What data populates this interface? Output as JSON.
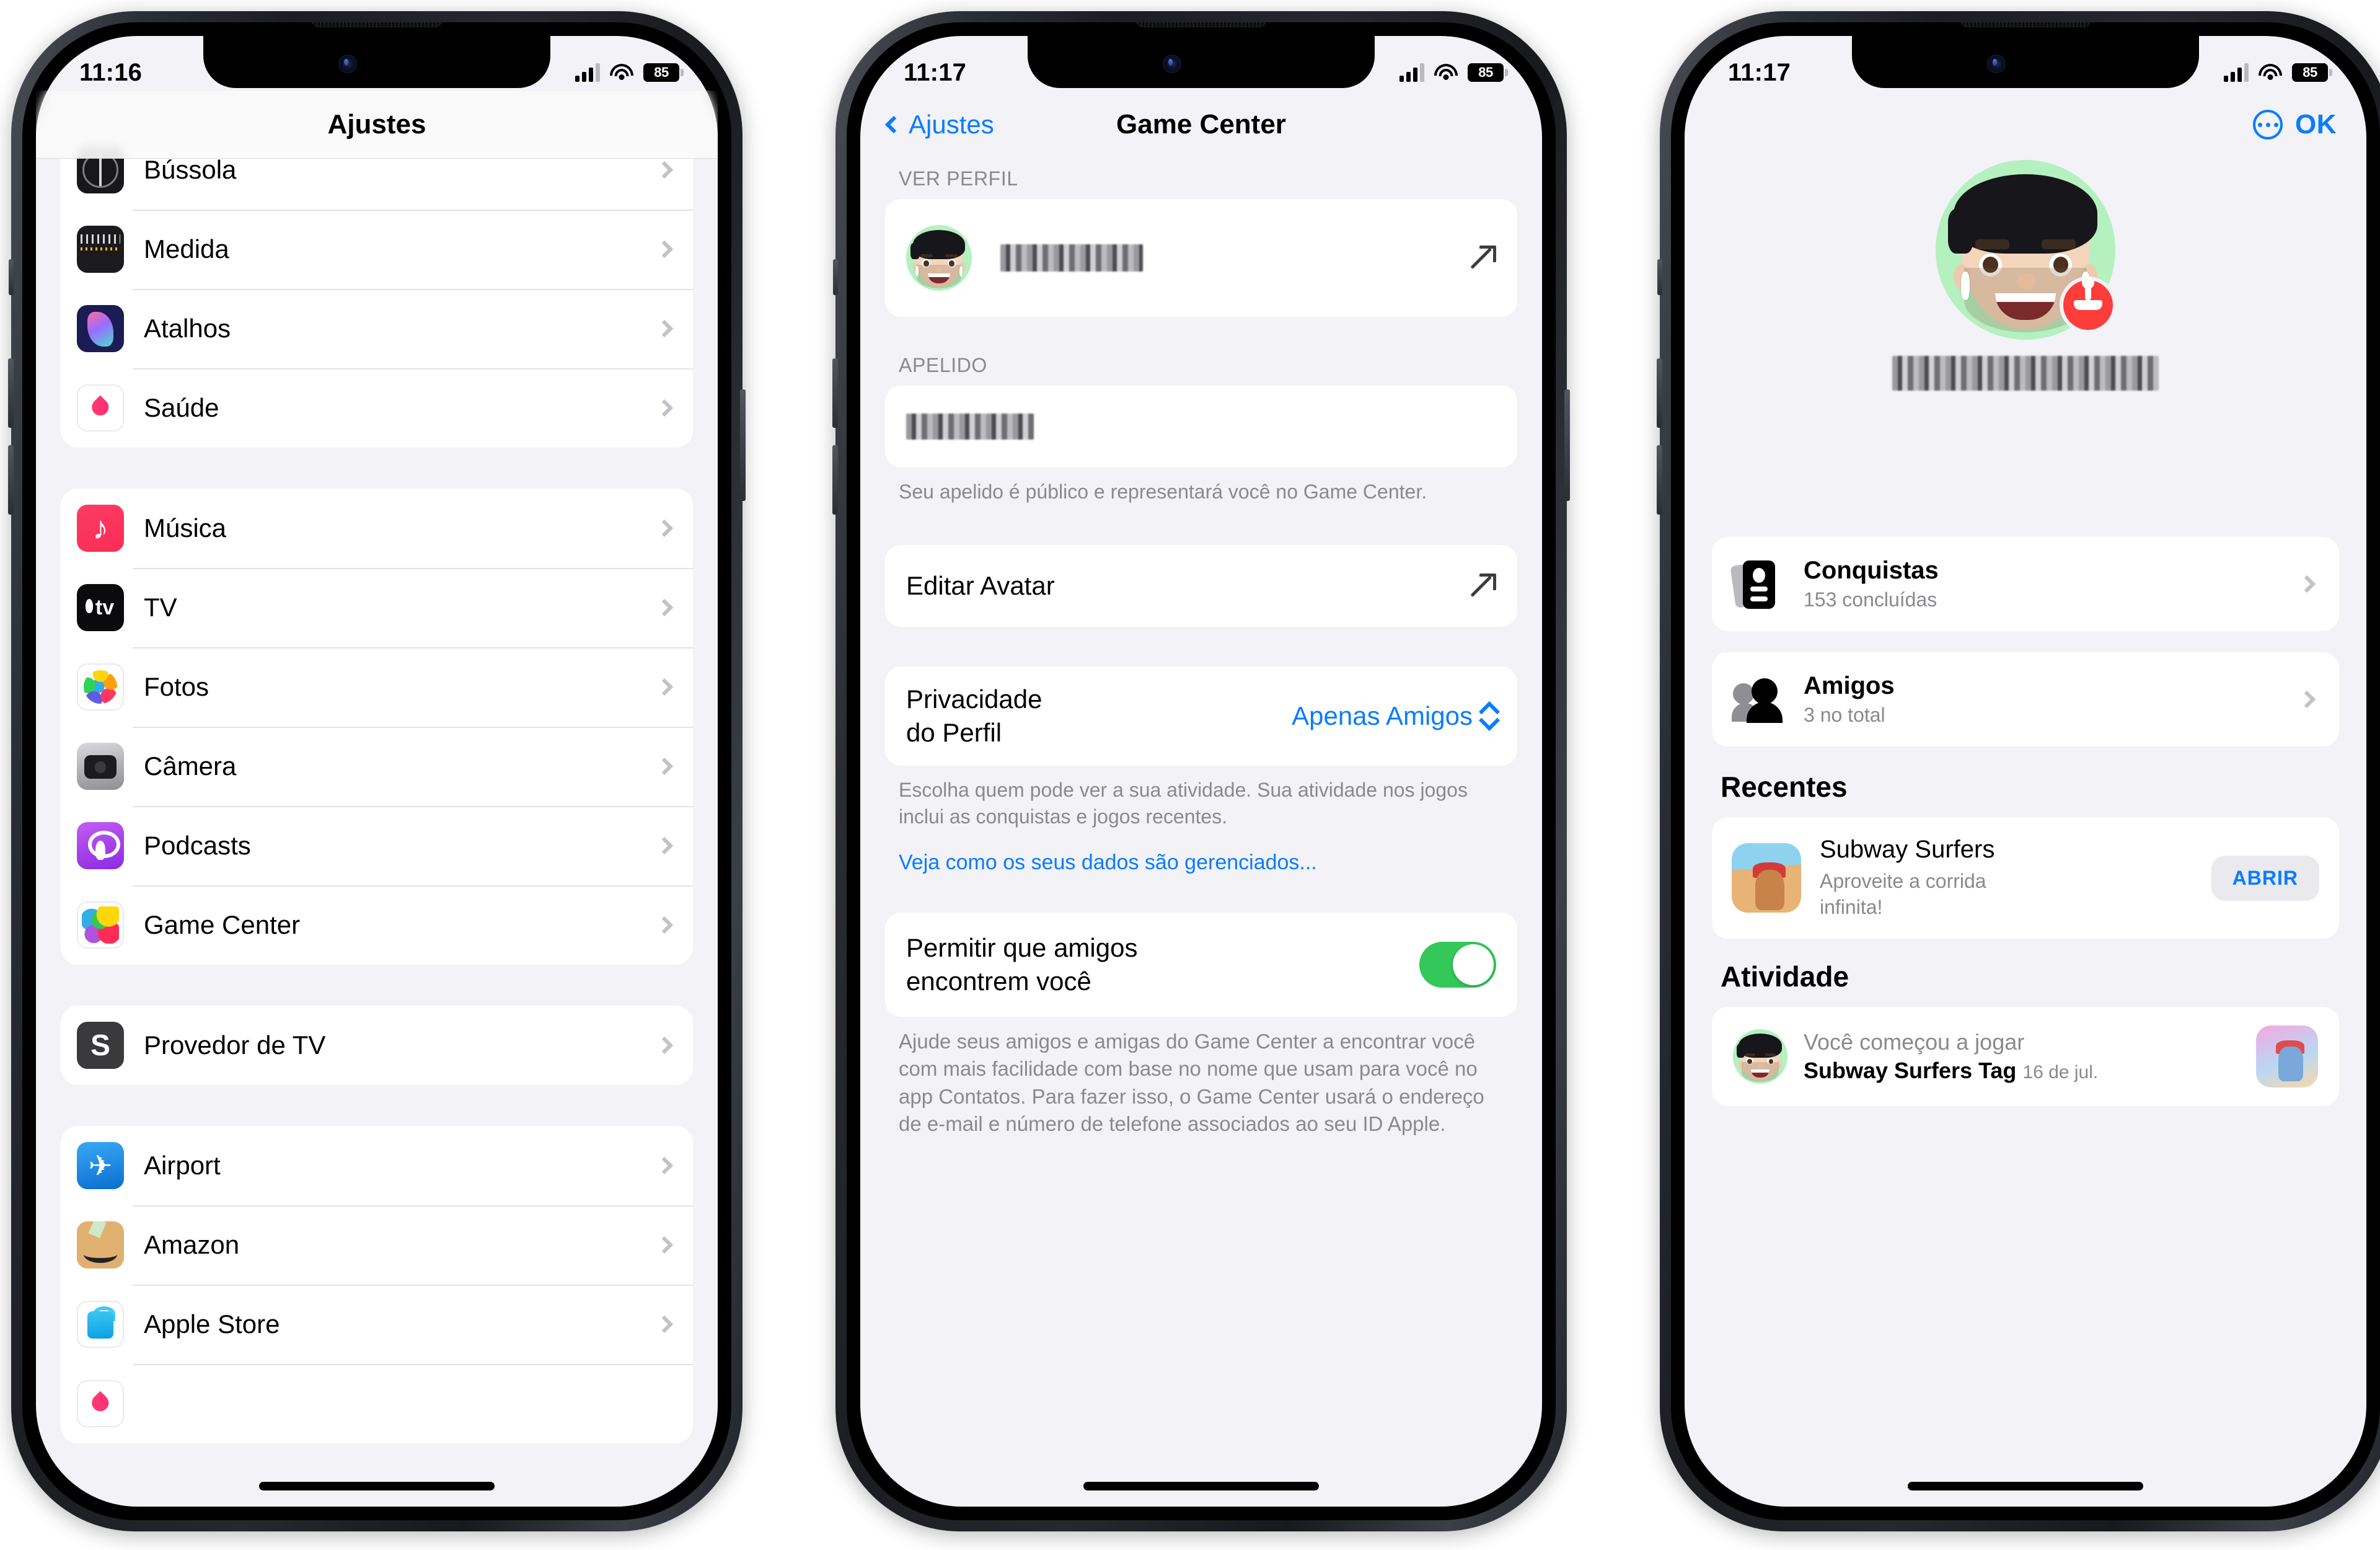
{
  "statusbar": {
    "time_1": "11:16",
    "time_2": "11:17",
    "time_3": "11:17",
    "battery": "85"
  },
  "screen1": {
    "nav_title": "Ajustes",
    "groups": [
      {
        "rows": [
          {
            "label": "Bússola",
            "icon": "compass-icon"
          },
          {
            "label": "Medida",
            "icon": "measure-icon"
          },
          {
            "label": "Atalhos",
            "icon": "shortcuts-icon"
          },
          {
            "label": "Saúde",
            "icon": "health-icon"
          }
        ]
      },
      {
        "rows": [
          {
            "label": "Música",
            "icon": "music-icon"
          },
          {
            "label": "TV",
            "icon": "tv-icon"
          },
          {
            "label": "Fotos",
            "icon": "photos-icon"
          },
          {
            "label": "Câmera",
            "icon": "camera-icon"
          },
          {
            "label": "Podcasts",
            "icon": "podcasts-icon"
          },
          {
            "label": "Game Center",
            "icon": "game-center-icon"
          }
        ]
      },
      {
        "rows": [
          {
            "label": "Provedor de TV",
            "icon": "tv-provider-icon"
          }
        ]
      },
      {
        "rows": [
          {
            "label": "Airport",
            "icon": "airport-icon"
          },
          {
            "label": "Amazon",
            "icon": "amazon-icon"
          },
          {
            "label": "Apple Store",
            "icon": "apple-store-icon"
          }
        ]
      }
    ]
  },
  "screen2": {
    "back_label": "Ajustes",
    "nav_title": "Game Center",
    "section_profile_label": "VER PERFIL",
    "profile_name_redacted": "",
    "section_nickname_label": "APELIDO",
    "nickname_redacted": "",
    "nickname_footnote": "Seu apelido é público e representará você no Game Center.",
    "edit_avatar_label": "Editar Avatar",
    "privacy_label_line1": "Privacidade",
    "privacy_label_line2": "do Perfil",
    "privacy_value": "Apenas Amigos",
    "privacy_footnote": "Escolha quem pode ver a sua atividade. Sua atividade nos jogos inclui as conquistas e jogos recentes.",
    "privacy_link": "Veja como os seus dados são gerenciados...",
    "friends_toggle_label_l1": "Permitir que amigos",
    "friends_toggle_label_l2": "encontrem você",
    "friends_toggle_state": "on",
    "friends_footnote": "Ajude seus amigos e amigas do Game Center a encontrar você com mais facilidade com base no nome que usam para você no app Contatos. Para fazer isso, o Game Center usará o endereço de e-mail e número de telefone associados ao seu ID Apple."
  },
  "screen3": {
    "ok_label": "OK",
    "nickname_redacted": "",
    "stats": [
      {
        "title": "Conquistas",
        "subtitle": "153 concluídas",
        "icon": "achievements-icon"
      },
      {
        "title": "Amigos",
        "subtitle": "3 no total",
        "icon": "friends-icon"
      }
    ],
    "recents_title": "Recentes",
    "recent_game": {
      "title": "Subway Surfers",
      "subtitle": "Aproveite a corrida infinita!",
      "button": "ABRIR"
    },
    "activity_title": "Atividade",
    "activity_item": {
      "prefix": "Você começou a jogar",
      "game": "Subway Surfers Tag",
      "date": "16 de jul."
    }
  },
  "colors": {
    "accent_blue": "#0a7cff",
    "toggle_green": "#34c759",
    "badge_red": "#fc3d39",
    "bg_grouped": "#f2f2f7"
  }
}
